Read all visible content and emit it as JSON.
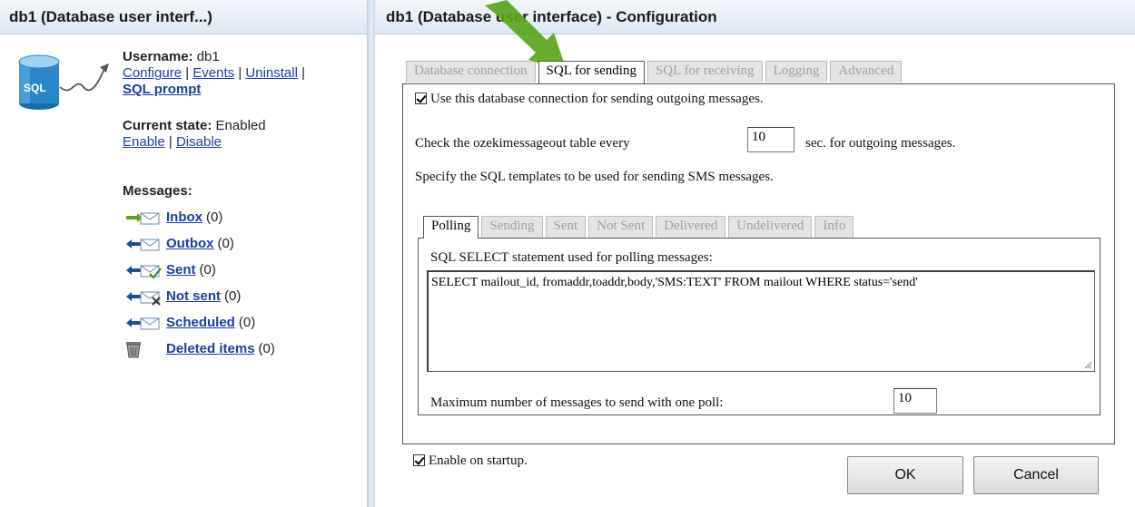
{
  "left": {
    "title": "db1 (Database user interf...)",
    "username_label": "Username:",
    "username": "db1",
    "links": {
      "configure": "Configure",
      "events": "Events",
      "uninstall": "Uninstall",
      "sql_prompt": "SQL prompt"
    },
    "sep": "|",
    "state_label": "Current state:",
    "state": "Enabled",
    "enable": "Enable",
    "disable": "Disable",
    "messages_title": "Messages:",
    "folders": [
      {
        "label": "Inbox",
        "count": "(0)",
        "icon": "inbox-envelope-icon"
      },
      {
        "label": "Outbox",
        "count": "(0)",
        "icon": "outbox-envelope-icon"
      },
      {
        "label": "Sent",
        "count": "(0)",
        "icon": "sent-envelope-icon"
      },
      {
        "label": "Not sent",
        "count": "(0)",
        "icon": "not-sent-envelope-icon"
      },
      {
        "label": "Scheduled",
        "count": "(0)",
        "icon": "scheduled-envelope-icon"
      },
      {
        "label": "Deleted items",
        "count": "(0)",
        "icon": "trash-icon"
      }
    ],
    "db_icon_text": "SQL"
  },
  "right": {
    "title": "db1 (Database user interface) - Configuration",
    "tabs": [
      "Database connection",
      "SQL for sending",
      "SQL for receiving",
      "Logging",
      "Advanced"
    ],
    "active_tab": "SQL for sending",
    "use_connection": "Use this database connection for sending outgoing messages.",
    "check_prefix": "Check the ozekimessageout table every",
    "check_interval": "10",
    "check_suffix": "sec. for outgoing messages.",
    "templates_text": "Specify the SQL templates to be used for sending SMS messages.",
    "sub_tabs": [
      "Polling",
      "Sending",
      "Sent",
      "Not Sent",
      "Delivered",
      "Undelivered",
      "Info"
    ],
    "active_sub_tab": "Polling",
    "select_label": "SQL SELECT statement used for polling messages:",
    "select_sql": "SELECT mailout_id, fromaddr,toaddr,body,'SMS:TEXT' FROM mailout WHERE status='send'",
    "max_label": "Maximum number of messages to send with one poll:",
    "max_value": "10",
    "enable_startup": "Enable on startup.",
    "ok": "OK",
    "cancel": "Cancel"
  },
  "colors": {
    "link": "#1a3ea8",
    "header_bg": "#dde8f3",
    "arrow": "#5aa51a"
  }
}
